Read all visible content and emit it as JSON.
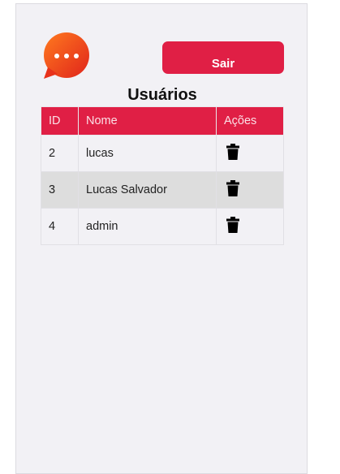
{
  "header": {
    "logout_label": "Sair",
    "title": "Usuários",
    "logo_icon": "chat-bubble-icon",
    "accent_color": "#e01f45"
  },
  "table": {
    "columns": [
      "ID",
      "Nome",
      "Ações"
    ],
    "rows": [
      {
        "id": "2",
        "name": "lucas",
        "action_icon": "trash-icon"
      },
      {
        "id": "3",
        "name": "Lucas Salvador",
        "action_icon": "trash-icon"
      },
      {
        "id": "4",
        "name": "admin",
        "action_icon": "trash-icon"
      }
    ]
  }
}
